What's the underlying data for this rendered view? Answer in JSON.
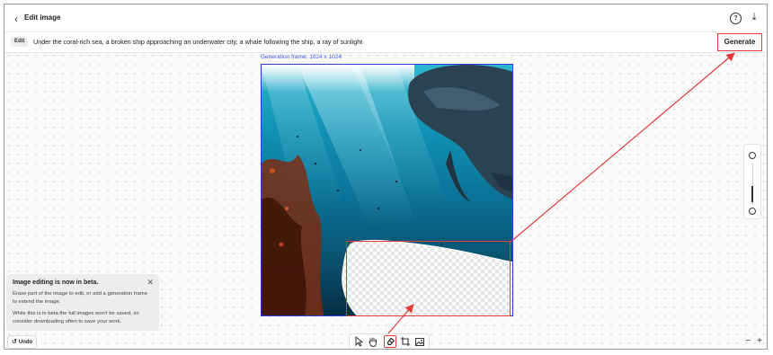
{
  "header": {
    "title": "Edit image",
    "back_icon": "back-arrow-icon",
    "help_icon": "help-icon",
    "download_icon": "download-icon"
  },
  "prompt": {
    "chip_label": "Edit",
    "text": "Under the coral-rich sea, a broken ship approaching an underwater city, a whale following the ship, a ray of sunlight",
    "generate_label": "Generate"
  },
  "canvas": {
    "frame_label": "Generation frame: 1024 x 1024"
  },
  "beta_notice": {
    "title": "Image editing is now in beta.",
    "paragraph1": "Erase part of the image to edit, or add a generation frame to extend the image.",
    "paragraph2": "While this is in beta the full images won't be saved, so consider downloading often to save your work."
  },
  "undo_label": "Undo",
  "toolbar": {
    "tools": [
      "select-tool",
      "pan-tool",
      "eraser-tool",
      "add-frame-tool",
      "upload-image-tool"
    ],
    "active_tool": "eraser-tool"
  },
  "zoom": {
    "minus": "−",
    "plus": "+"
  },
  "colors": {
    "annotation": "#e23b3b",
    "frame_border": "#2f3bd1",
    "frame_label": "#3b5bdb"
  }
}
